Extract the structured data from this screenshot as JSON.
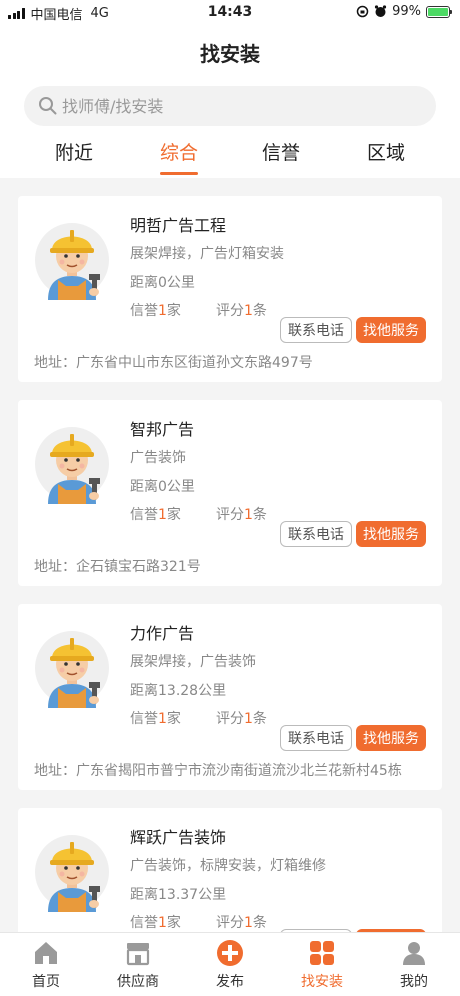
{
  "status": {
    "carrier": "中国电信",
    "network": "4G",
    "time": "14:43",
    "battery": "99%"
  },
  "header": {
    "title": "找安装",
    "search_placeholder": "找师傅/找安装"
  },
  "tabs": [
    {
      "label": "附近"
    },
    {
      "label": "综合"
    },
    {
      "label": "信誉"
    },
    {
      "label": "区域"
    }
  ],
  "active_tab": "综合",
  "labels": {
    "credit_prefix": "信誉",
    "credit_unit": "家",
    "score_prefix": "评分",
    "score_unit": "条",
    "call_button": "联系电话",
    "service_button": "找他服务"
  },
  "providers": [
    {
      "name": "明哲广告工程",
      "services": "展架焊接，广告灯箱安装",
      "distance": "距离0公里",
      "credit": "1",
      "score": "1",
      "address": "地址：广东省中山市东区街道孙文东路497号"
    },
    {
      "name": "智邦广告",
      "services": "广告装饰",
      "distance": "距离0公里",
      "credit": "1",
      "score": "1",
      "address": "地址：企石镇宝石路321号"
    },
    {
      "name": "力作广告",
      "services": "展架焊接，广告装饰",
      "distance": "距离13.28公里",
      "credit": "1",
      "score": "1",
      "address": "地址：广东省揭阳市普宁市流沙南街道流沙北兰花新村45栋"
    },
    {
      "name": "辉跃广告装饰",
      "services": "广告装饰，标牌安装，灯箱维修",
      "distance": "距离13.37公里",
      "credit": "1",
      "score": "1",
      "address": ""
    }
  ],
  "tabbar": [
    {
      "label": "首页",
      "icon": "home-icon"
    },
    {
      "label": "供应商",
      "icon": "store-icon"
    },
    {
      "label": "发布",
      "icon": "plus-circle-icon"
    },
    {
      "label": "找安装",
      "icon": "grid-icon"
    },
    {
      "label": "我的",
      "icon": "user-icon"
    }
  ],
  "active_tabbar": "找安装",
  "colors": {
    "accent": "#f06c2f",
    "text": "#222222",
    "muted": "#888888",
    "background": "#f4f4f4"
  }
}
